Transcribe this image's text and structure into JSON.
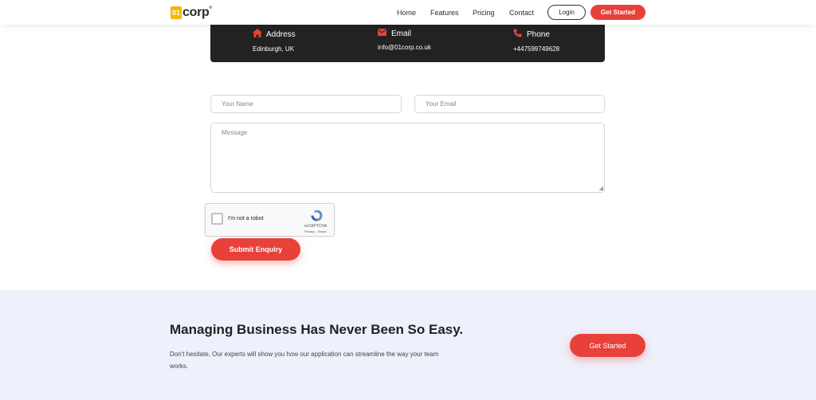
{
  "header": {
    "logo_box": "01",
    "logo_text": "corp",
    "logo_reg": "®",
    "nav": [
      {
        "label": "Home"
      },
      {
        "label": "Features"
      },
      {
        "label": "Pricing"
      },
      {
        "label": "Contact"
      }
    ],
    "login_label": "Login",
    "get_started_label": "Get Started"
  },
  "contact": {
    "address": {
      "title": "Address",
      "value": "Edinburgh, UK",
      "icon": "home-icon"
    },
    "email": {
      "title": "Email",
      "value": "info@01corp.co.uk",
      "icon": "envelope-icon"
    },
    "phone": {
      "title": "Phone",
      "value": "+447599749628",
      "icon": "phone-icon"
    }
  },
  "form": {
    "name_placeholder": "Your Name",
    "email_placeholder": "Your Email",
    "message_placeholder": "Message",
    "captcha_label": "I'm not a robot",
    "captcha_brand": "reCAPTCHA",
    "captcha_terms": "Privacy - Terms",
    "submit_label": "Submit Enquiry"
  },
  "cta": {
    "title": "Managing Business Has Never Been So Easy.",
    "description": "Don't hesitate, Our experts will show you how our application can streamline the way your team works.",
    "button_label": "Get Started"
  },
  "colors": {
    "accent": "#e8413a",
    "logo": "#f2b705",
    "dark_strip": "#222222",
    "cta_background": "#eef0fb"
  }
}
